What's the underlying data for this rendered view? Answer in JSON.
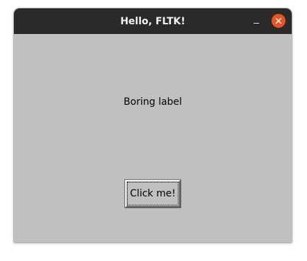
{
  "window": {
    "title": "Hello, FLTK!",
    "controls": {
      "minimize_icon": "minimize-icon",
      "close_icon": "close-icon"
    }
  },
  "content": {
    "label_text": "Boring label",
    "button_label": "Click me!"
  },
  "colors": {
    "titlebar": "#2c2a29",
    "client_background": "#c0c0c0",
    "close_button": "#e95420",
    "title_text": "#f2f2f2"
  }
}
